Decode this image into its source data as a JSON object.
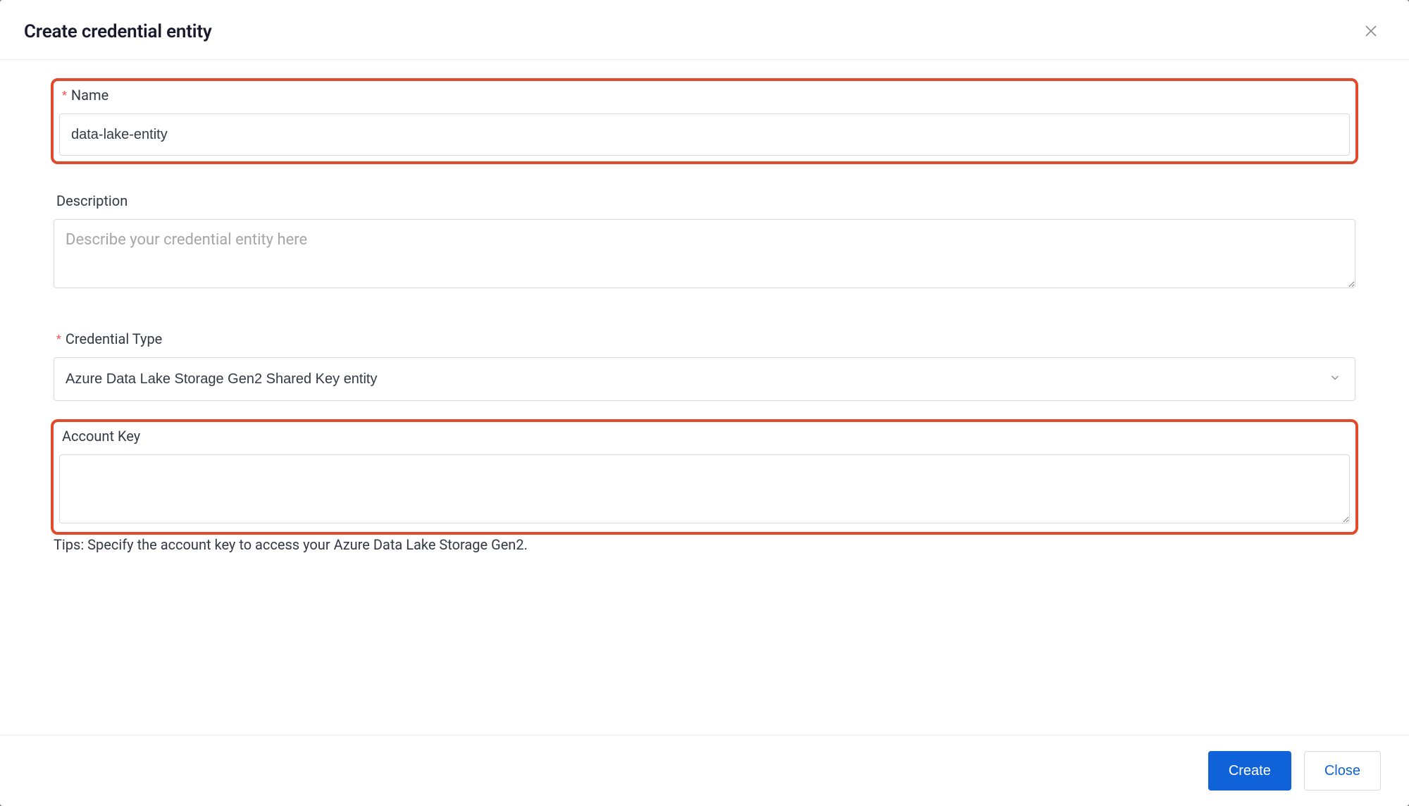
{
  "modal": {
    "title": "Create credential entity",
    "buttons": {
      "create": "Create",
      "close": "Close"
    }
  },
  "form": {
    "name": {
      "label": "Name",
      "value": "data-lake-entity"
    },
    "description": {
      "label": "Description",
      "placeholder": "Describe your credential entity here",
      "value": ""
    },
    "credential_type": {
      "label": "Credential Type",
      "value": "Azure Data Lake Storage Gen2 Shared Key entity"
    },
    "account_key": {
      "label": "Account Key",
      "value": ""
    },
    "tips": "Tips: Specify the account key to access your Azure Data Lake Storage Gen2."
  }
}
